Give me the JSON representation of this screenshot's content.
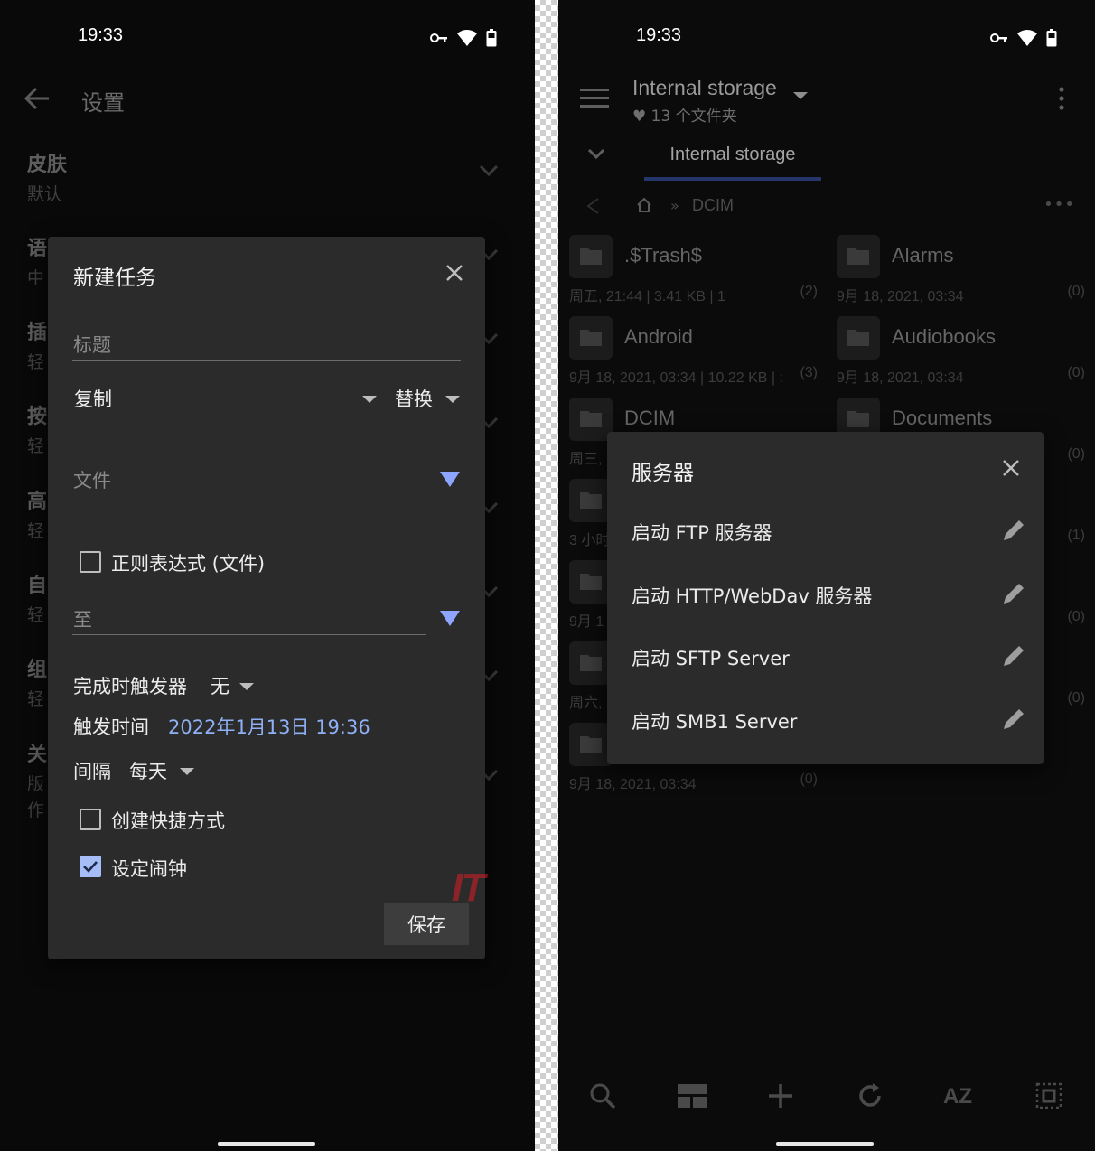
{
  "left_phone": {
    "status": {
      "time": "19:33"
    },
    "settings_header": {
      "title": "设置"
    },
    "settings_items": [
      {
        "title": "皮肤",
        "subtitle": "默认"
      },
      {
        "title": "语",
        "subtitle": "中"
      },
      {
        "title": "插",
        "subtitle": "轻"
      },
      {
        "title": "按",
        "subtitle": "轻"
      },
      {
        "title": "高",
        "subtitle": "轻"
      },
      {
        "title": "自",
        "subtitle": "轻"
      },
      {
        "title": "组",
        "subtitle": "轻"
      },
      {
        "title": "关",
        "subtitle": "版",
        "subtitle2": "作"
      }
    ],
    "new_task_dialog": {
      "title": "新建任务",
      "title_placeholder": "标题",
      "operation": "复制",
      "mode": "替换",
      "file_hint": "文件",
      "regex_checkbox": {
        "label": "正则表达式 (文件)",
        "checked": false
      },
      "to_hint": "至",
      "trigger_label": "完成时触发器",
      "trigger_value": "无",
      "time_label": "触发时间",
      "time_value": "2022年1月13日 19:36",
      "interval_label": "间隔",
      "interval_value": "每天",
      "shortcut_checkbox": {
        "label": "创建快捷方式",
        "checked": false
      },
      "alarm_checkbox": {
        "label": "设定闹钟",
        "checked": true
      },
      "save_button": "保存"
    },
    "watermark": "IT"
  },
  "right_phone": {
    "status": {
      "time": "19:33"
    },
    "header": {
      "title": "Internal storage",
      "subtitle": "13 个文件夹"
    },
    "tab": {
      "label": "Internal storage"
    },
    "path": {
      "current": "DCIM",
      "separator": "»",
      "more": "•••"
    },
    "folders": [
      {
        "name": ".$Trash$",
        "meta": "周五, 21:44 | 3.41  KB | 1",
        "count": "(2)"
      },
      {
        "name": "Alarms",
        "meta": "9月 18, 2021, 03:34",
        "count": "(0)"
      },
      {
        "name": "Android",
        "meta": "9月 18, 2021, 03:34 | 10.22  KB | :",
        "count": "(3)"
      },
      {
        "name": "Audiobooks",
        "meta": "9月 18, 2021, 03:34",
        "count": "(0)"
      },
      {
        "name": "DCIM",
        "meta": "周三,",
        "count": ""
      },
      {
        "name": "Documents",
        "meta": "",
        "count": "(0)"
      },
      {
        "name": "",
        "meta": "3 小时",
        "count": ""
      },
      {
        "name": "",
        "meta": "",
        "count": "(1)"
      },
      {
        "name": "",
        "meta": "9月 1",
        "count": ""
      },
      {
        "name": "",
        "meta": "",
        "count": "(0)"
      },
      {
        "name": "",
        "meta": "周六,",
        "count": ""
      },
      {
        "name": "",
        "meta": "",
        "count": "(0)"
      },
      {
        "name": "",
        "meta": "9月 18, 2021, 03:34",
        "count": "(0)"
      }
    ],
    "server_dialog": {
      "title": "服务器",
      "items": [
        {
          "label": "启动 FTP 服务器"
        },
        {
          "label": "启动 HTTP/WebDav 服务器"
        },
        {
          "label": "启动 SFTP Server"
        },
        {
          "label": "启动 SMB1 Server"
        }
      ]
    },
    "bottom_bar": {
      "sort_label": "AZ"
    }
  }
}
